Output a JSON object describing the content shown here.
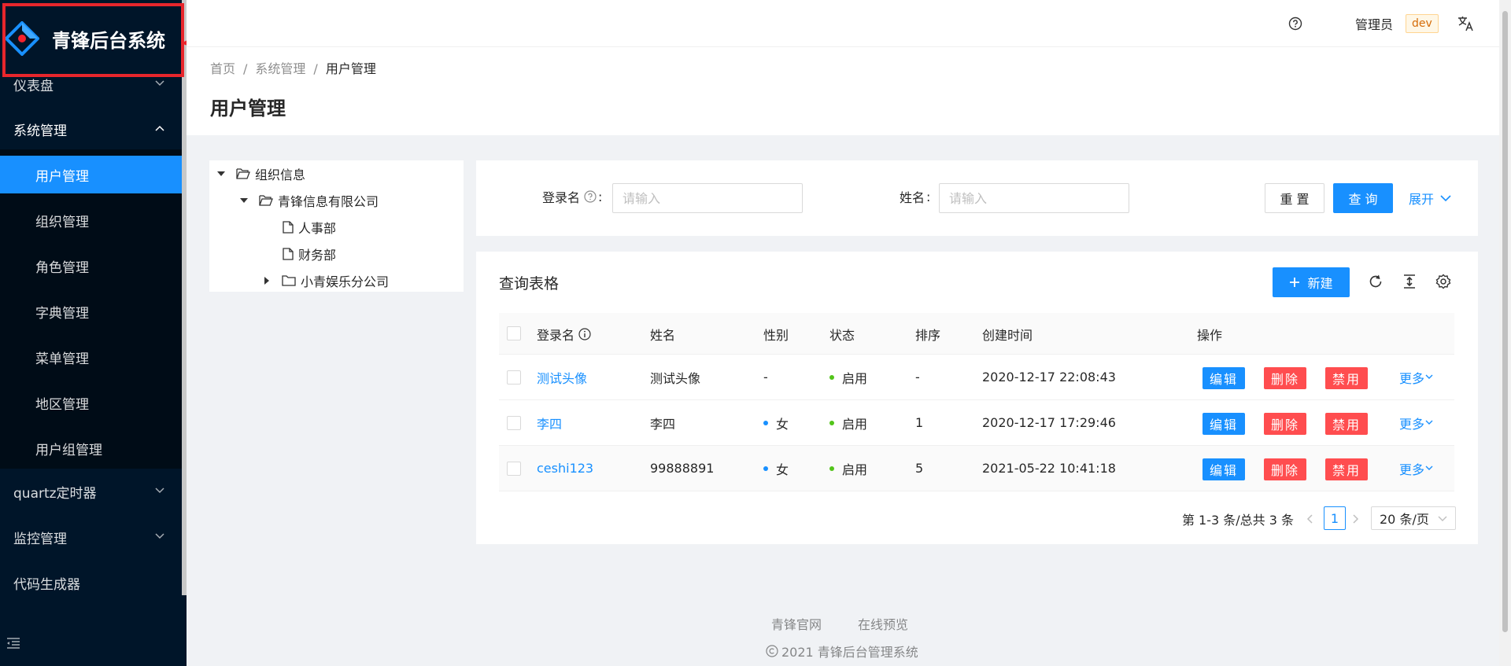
{
  "app": {
    "title": "青锋后台系统"
  },
  "sidebar": {
    "menus": [
      {
        "label": "仪表盘",
        "expanded": false
      },
      {
        "label": "系统管理",
        "expanded": true
      },
      {
        "label": "quartz定时器",
        "expanded": false
      },
      {
        "label": "监控管理",
        "expanded": false
      },
      {
        "label": "代码生成器",
        "expanded": false
      }
    ],
    "submenu": [
      {
        "label": "用户管理",
        "active": true
      },
      {
        "label": "组织管理"
      },
      {
        "label": "角色管理"
      },
      {
        "label": "字典管理"
      },
      {
        "label": "菜单管理"
      },
      {
        "label": "地区管理"
      },
      {
        "label": "用户组管理"
      }
    ]
  },
  "header": {
    "user": "管理员",
    "env_tag": "dev"
  },
  "breadcrumb": [
    "首页",
    "系统管理",
    "用户管理"
  ],
  "page_title": "用户管理",
  "tree": {
    "root": "组织信息",
    "company": "青锋信息有限公司",
    "departments": [
      "人事部",
      "财务部"
    ],
    "subsidiary": "小青娱乐分公司"
  },
  "search": {
    "login_label": "登录名",
    "name_label": "姓名",
    "colon": ":",
    "placeholder": "请输入",
    "reset": "重 置",
    "query": "查 询",
    "expand": "展开"
  },
  "table": {
    "title": "查询表格",
    "new_button": "新建",
    "columns": [
      "登录名",
      "姓名",
      "性别",
      "状态",
      "排序",
      "创建时间",
      "操作"
    ],
    "rows": [
      {
        "login": "测试头像",
        "name": "测试头像",
        "gender": "-",
        "status": "启用",
        "sort": "-",
        "created": "2020-12-17 22:08:43"
      },
      {
        "login": "李四",
        "name": "李四",
        "gender": "女",
        "status": "启用",
        "sort": "1",
        "created": "2020-12-17 17:29:46"
      },
      {
        "login": "ceshi123",
        "name": "99888891",
        "gender": "女",
        "status": "启用",
        "sort": "5",
        "created": "2021-05-22 10:41:18"
      }
    ],
    "actions": {
      "edit": "编辑",
      "delete": "删除",
      "disable": "禁用",
      "more": "更多"
    }
  },
  "pagination": {
    "total_text": "第 1-3 条/总共 3 条",
    "current": "1",
    "page_size": "20 条/页"
  },
  "footer": {
    "link1": "青锋官网",
    "link2": "在线预览",
    "copyright": "2021 青锋后台管理系统"
  },
  "colors": {
    "primary": "#1890ff",
    "danger": "#ff4d4f",
    "sider": "#001529",
    "success": "#52c41a",
    "annotation": "#e8262c"
  }
}
